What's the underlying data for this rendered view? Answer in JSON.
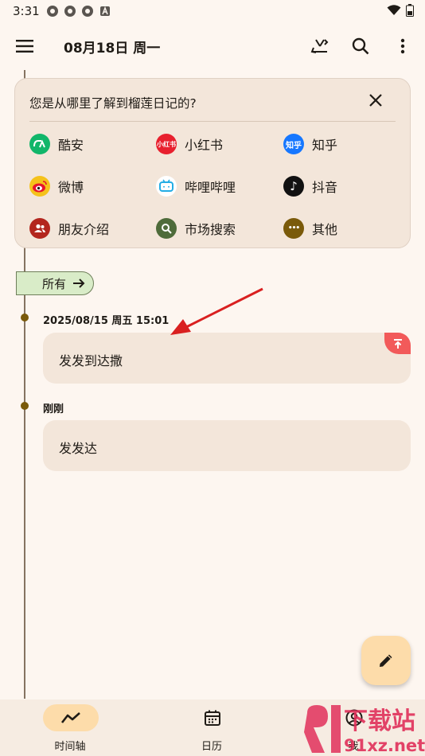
{
  "status_bar": {
    "time": "3:31"
  },
  "app_bar": {
    "title": "08月18日 周一"
  },
  "survey": {
    "question": "您是从哪里了解到榴莲日记的?",
    "options": [
      {
        "label": "酷安",
        "icon": "coolapk-icon",
        "color": "#11b66a",
        "glyph": "CA"
      },
      {
        "label": "小红书",
        "icon": "xiaohongshu-icon",
        "color": "#e8202e",
        "glyph": "小红书"
      },
      {
        "label": "知乎",
        "icon": "zhihu-icon",
        "color": "#1677ff",
        "glyph": "知乎"
      },
      {
        "label": "微博",
        "icon": "weibo-icon",
        "color": "#f5c21b",
        "glyph": ""
      },
      {
        "label": "哔哩哔哩",
        "icon": "bilibili-icon",
        "color": "#ffffff",
        "glyph": ""
      },
      {
        "label": "抖音",
        "icon": "douyin-icon",
        "color": "#111111",
        "glyph": "♪"
      },
      {
        "label": "朋友介绍",
        "icon": "friends-icon",
        "color": "#b3261e",
        "glyph": ""
      },
      {
        "label": "市场搜索",
        "icon": "market-search-icon",
        "color": "#4e6b3a",
        "glyph": ""
      },
      {
        "label": "其他",
        "icon": "more-icon",
        "color": "#7a5a0a",
        "glyph": "•••"
      }
    ]
  },
  "filter": {
    "label": "所有"
  },
  "entries": [
    {
      "time": "2025/08/15 周五 15:01",
      "text": "发发到达撒",
      "pinned": true
    },
    {
      "time": "刚刚",
      "text": "发发达",
      "pinned": false
    }
  ],
  "bottom_nav": {
    "items": [
      {
        "label": "时间轴",
        "active": true
      },
      {
        "label": "日历",
        "active": false
      },
      {
        "label": "我",
        "active": false
      }
    ]
  },
  "watermark": {
    "line1": "下载站",
    "line2": "91xz.net"
  },
  "colors": {
    "background": "#fdf6f0",
    "card": "#f3e6da",
    "accent": "#fddcaa",
    "timeline": "#857361",
    "chip": "#d9ecc8",
    "pin": "#f25a5a"
  }
}
